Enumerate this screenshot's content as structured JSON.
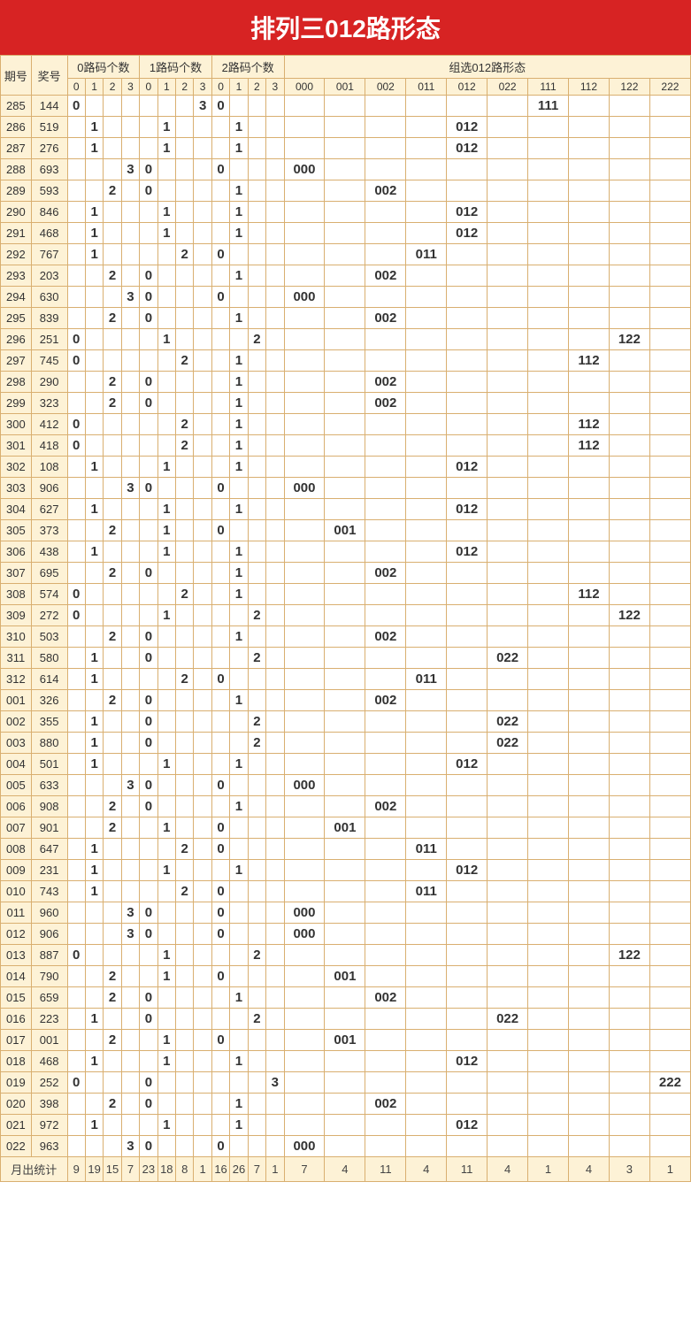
{
  "title": "排列三012路形态",
  "header": {
    "period": "期号",
    "prize": "奖号",
    "group0": "0路码个数",
    "group1": "1路码个数",
    "group2": "2路码个数",
    "pattern": "组选012路形态",
    "counts": [
      "0",
      "1",
      "2",
      "3"
    ],
    "patterns": [
      "000",
      "001",
      "002",
      "011",
      "012",
      "022",
      "111",
      "112",
      "122",
      "222"
    ],
    "footer": "月出统计"
  },
  "rows": [
    {
      "q": "285",
      "p": "144",
      "c0": [
        0,
        null,
        null,
        null
      ],
      "c1": [
        null,
        null,
        null,
        3
      ],
      "c2": [
        0,
        null,
        null,
        null
      ],
      "pat": "111"
    },
    {
      "q": "286",
      "p": "519",
      "c0": [
        null,
        1,
        null,
        null
      ],
      "c1": [
        null,
        1,
        null,
        null
      ],
      "c2": [
        null,
        1,
        null,
        null
      ],
      "pat": "012"
    },
    {
      "q": "287",
      "p": "276",
      "c0": [
        null,
        1,
        null,
        null
      ],
      "c1": [
        null,
        1,
        null,
        null
      ],
      "c2": [
        null,
        1,
        null,
        null
      ],
      "pat": "012"
    },
    {
      "q": "288",
      "p": "693",
      "c0": [
        null,
        null,
        null,
        3
      ],
      "c1": [
        0,
        null,
        null,
        null
      ],
      "c2": [
        0,
        null,
        null,
        null
      ],
      "pat": "000"
    },
    {
      "q": "289",
      "p": "593",
      "c0": [
        null,
        null,
        2,
        null
      ],
      "c1": [
        0,
        null,
        null,
        null
      ],
      "c2": [
        null,
        1,
        null,
        null
      ],
      "pat": "002"
    },
    {
      "q": "290",
      "p": "846",
      "c0": [
        null,
        1,
        null,
        null
      ],
      "c1": [
        null,
        1,
        null,
        null
      ],
      "c2": [
        null,
        1,
        null,
        null
      ],
      "pat": "012"
    },
    {
      "q": "291",
      "p": "468",
      "c0": [
        null,
        1,
        null,
        null
      ],
      "c1": [
        null,
        1,
        null,
        null
      ],
      "c2": [
        null,
        1,
        null,
        null
      ],
      "pat": "012"
    },
    {
      "q": "292",
      "p": "767",
      "c0": [
        null,
        1,
        null,
        null
      ],
      "c1": [
        null,
        null,
        2,
        null
      ],
      "c2": [
        0,
        null,
        null,
        null
      ],
      "pat": "011"
    },
    {
      "q": "293",
      "p": "203",
      "c0": [
        null,
        null,
        2,
        null
      ],
      "c1": [
        0,
        null,
        null,
        null
      ],
      "c2": [
        null,
        1,
        null,
        null
      ],
      "pat": "002"
    },
    {
      "q": "294",
      "p": "630",
      "c0": [
        null,
        null,
        null,
        3
      ],
      "c1": [
        0,
        null,
        null,
        null
      ],
      "c2": [
        0,
        null,
        null,
        null
      ],
      "pat": "000"
    },
    {
      "q": "295",
      "p": "839",
      "c0": [
        null,
        null,
        2,
        null
      ],
      "c1": [
        0,
        null,
        null,
        null
      ],
      "c2": [
        null,
        1,
        null,
        null
      ],
      "pat": "002"
    },
    {
      "q": "296",
      "p": "251",
      "c0": [
        0,
        null,
        null,
        null
      ],
      "c1": [
        null,
        1,
        null,
        null
      ],
      "c2": [
        null,
        null,
        2,
        null
      ],
      "pat": "122"
    },
    {
      "q": "297",
      "p": "745",
      "c0": [
        0,
        null,
        null,
        null
      ],
      "c1": [
        null,
        null,
        2,
        null
      ],
      "c2": [
        null,
        1,
        null,
        null
      ],
      "pat": "112"
    },
    {
      "q": "298",
      "p": "290",
      "c0": [
        null,
        null,
        2,
        null
      ],
      "c1": [
        0,
        null,
        null,
        null
      ],
      "c2": [
        null,
        1,
        null,
        null
      ],
      "pat": "002"
    },
    {
      "q": "299",
      "p": "323",
      "c0": [
        null,
        null,
        2,
        null
      ],
      "c1": [
        0,
        null,
        null,
        null
      ],
      "c2": [
        null,
        1,
        null,
        null
      ],
      "pat": "002"
    },
    {
      "q": "300",
      "p": "412",
      "c0": [
        0,
        null,
        null,
        null
      ],
      "c1": [
        null,
        null,
        2,
        null
      ],
      "c2": [
        null,
        1,
        null,
        null
      ],
      "pat": "112"
    },
    {
      "q": "301",
      "p": "418",
      "c0": [
        0,
        null,
        null,
        null
      ],
      "c1": [
        null,
        null,
        2,
        null
      ],
      "c2": [
        null,
        1,
        null,
        null
      ],
      "pat": "112"
    },
    {
      "q": "302",
      "p": "108",
      "c0": [
        null,
        1,
        null,
        null
      ],
      "c1": [
        null,
        1,
        null,
        null
      ],
      "c2": [
        null,
        1,
        null,
        null
      ],
      "pat": "012"
    },
    {
      "q": "303",
      "p": "906",
      "c0": [
        null,
        null,
        null,
        3
      ],
      "c1": [
        0,
        null,
        null,
        null
      ],
      "c2": [
        0,
        null,
        null,
        null
      ],
      "pat": "000"
    },
    {
      "q": "304",
      "p": "627",
      "c0": [
        null,
        1,
        null,
        null
      ],
      "c1": [
        null,
        1,
        null,
        null
      ],
      "c2": [
        null,
        1,
        null,
        null
      ],
      "pat": "012"
    },
    {
      "q": "305",
      "p": "373",
      "c0": [
        null,
        null,
        2,
        null
      ],
      "c1": [
        null,
        1,
        null,
        null
      ],
      "c2": [
        0,
        null,
        null,
        null
      ],
      "pat": "001"
    },
    {
      "q": "306",
      "p": "438",
      "c0": [
        null,
        1,
        null,
        null
      ],
      "c1": [
        null,
        1,
        null,
        null
      ],
      "c2": [
        null,
        1,
        null,
        null
      ],
      "pat": "012"
    },
    {
      "q": "307",
      "p": "695",
      "c0": [
        null,
        null,
        2,
        null
      ],
      "c1": [
        0,
        null,
        null,
        null
      ],
      "c2": [
        null,
        1,
        null,
        null
      ],
      "pat": "002"
    },
    {
      "q": "308",
      "p": "574",
      "c0": [
        0,
        null,
        null,
        null
      ],
      "c1": [
        null,
        null,
        2,
        null
      ],
      "c2": [
        null,
        1,
        null,
        null
      ],
      "pat": "112"
    },
    {
      "q": "309",
      "p": "272",
      "c0": [
        0,
        null,
        null,
        null
      ],
      "c1": [
        null,
        1,
        null,
        null
      ],
      "c2": [
        null,
        null,
        2,
        null
      ],
      "pat": "122"
    },
    {
      "q": "310",
      "p": "503",
      "c0": [
        null,
        null,
        2,
        null
      ],
      "c1": [
        0,
        null,
        null,
        null
      ],
      "c2": [
        null,
        1,
        null,
        null
      ],
      "pat": "002"
    },
    {
      "q": "311",
      "p": "580",
      "c0": [
        null,
        1,
        null,
        null
      ],
      "c1": [
        0,
        null,
        null,
        null
      ],
      "c2": [
        null,
        null,
        2,
        null
      ],
      "pat": "022"
    },
    {
      "q": "312",
      "p": "614",
      "c0": [
        null,
        1,
        null,
        null
      ],
      "c1": [
        null,
        null,
        2,
        null
      ],
      "c2": [
        0,
        null,
        null,
        null
      ],
      "pat": "011"
    },
    {
      "q": "001",
      "p": "326",
      "c0": [
        null,
        null,
        2,
        null
      ],
      "c1": [
        0,
        null,
        null,
        null
      ],
      "c2": [
        null,
        1,
        null,
        null
      ],
      "pat": "002"
    },
    {
      "q": "002",
      "p": "355",
      "c0": [
        null,
        1,
        null,
        null
      ],
      "c1": [
        0,
        null,
        null,
        null
      ],
      "c2": [
        null,
        null,
        2,
        null
      ],
      "pat": "022"
    },
    {
      "q": "003",
      "p": "880",
      "c0": [
        null,
        1,
        null,
        null
      ],
      "c1": [
        0,
        null,
        null,
        null
      ],
      "c2": [
        null,
        null,
        2,
        null
      ],
      "pat": "022"
    },
    {
      "q": "004",
      "p": "501",
      "c0": [
        null,
        1,
        null,
        null
      ],
      "c1": [
        null,
        1,
        null,
        null
      ],
      "c2": [
        null,
        1,
        null,
        null
      ],
      "pat": "012"
    },
    {
      "q": "005",
      "p": "633",
      "c0": [
        null,
        null,
        null,
        3
      ],
      "c1": [
        0,
        null,
        null,
        null
      ],
      "c2": [
        0,
        null,
        null,
        null
      ],
      "pat": "000"
    },
    {
      "q": "006",
      "p": "908",
      "c0": [
        null,
        null,
        2,
        null
      ],
      "c1": [
        0,
        null,
        null,
        null
      ],
      "c2": [
        null,
        1,
        null,
        null
      ],
      "pat": "002"
    },
    {
      "q": "007",
      "p": "901",
      "c0": [
        null,
        null,
        2,
        null
      ],
      "c1": [
        null,
        1,
        null,
        null
      ],
      "c2": [
        0,
        null,
        null,
        null
      ],
      "pat": "001"
    },
    {
      "q": "008",
      "p": "647",
      "c0": [
        null,
        1,
        null,
        null
      ],
      "c1": [
        null,
        null,
        2,
        null
      ],
      "c2": [
        0,
        null,
        null,
        null
      ],
      "pat": "011"
    },
    {
      "q": "009",
      "p": "231",
      "c0": [
        null,
        1,
        null,
        null
      ],
      "c1": [
        null,
        1,
        null,
        null
      ],
      "c2": [
        null,
        1,
        null,
        null
      ],
      "pat": "012"
    },
    {
      "q": "010",
      "p": "743",
      "c0": [
        null,
        1,
        null,
        null
      ],
      "c1": [
        null,
        null,
        2,
        null
      ],
      "c2": [
        0,
        null,
        null,
        null
      ],
      "pat": "011"
    },
    {
      "q": "011",
      "p": "960",
      "c0": [
        null,
        null,
        null,
        3
      ],
      "c1": [
        0,
        null,
        null,
        null
      ],
      "c2": [
        0,
        null,
        null,
        null
      ],
      "pat": "000"
    },
    {
      "q": "012",
      "p": "906",
      "c0": [
        null,
        null,
        null,
        3
      ],
      "c1": [
        0,
        null,
        null,
        null
      ],
      "c2": [
        0,
        null,
        null,
        null
      ],
      "pat": "000"
    },
    {
      "q": "013",
      "p": "887",
      "c0": [
        0,
        null,
        null,
        null
      ],
      "c1": [
        null,
        1,
        null,
        null
      ],
      "c2": [
        null,
        null,
        2,
        null
      ],
      "pat": "122"
    },
    {
      "q": "014",
      "p": "790",
      "c0": [
        null,
        null,
        2,
        null
      ],
      "c1": [
        null,
        1,
        null,
        null
      ],
      "c2": [
        0,
        null,
        null,
        null
      ],
      "pat": "001"
    },
    {
      "q": "015",
      "p": "659",
      "c0": [
        null,
        null,
        2,
        null
      ],
      "c1": [
        0,
        null,
        null,
        null
      ],
      "c2": [
        null,
        1,
        null,
        null
      ],
      "pat": "002"
    },
    {
      "q": "016",
      "p": "223",
      "c0": [
        null,
        1,
        null,
        null
      ],
      "c1": [
        0,
        null,
        null,
        null
      ],
      "c2": [
        null,
        null,
        2,
        null
      ],
      "pat": "022"
    },
    {
      "q": "017",
      "p": "001",
      "c0": [
        null,
        null,
        2,
        null
      ],
      "c1": [
        null,
        1,
        null,
        null
      ],
      "c2": [
        0,
        null,
        null,
        null
      ],
      "pat": "001"
    },
    {
      "q": "018",
      "p": "468",
      "c0": [
        null,
        1,
        null,
        null
      ],
      "c1": [
        null,
        1,
        null,
        null
      ],
      "c2": [
        null,
        1,
        null,
        null
      ],
      "pat": "012"
    },
    {
      "q": "019",
      "p": "252",
      "c0": [
        0,
        null,
        null,
        null
      ],
      "c1": [
        0,
        null,
        null,
        null
      ],
      "c2": [
        null,
        null,
        null,
        3
      ],
      "pat": "222"
    },
    {
      "q": "020",
      "p": "398",
      "c0": [
        null,
        null,
        2,
        null
      ],
      "c1": [
        0,
        null,
        null,
        null
      ],
      "c2": [
        null,
        1,
        null,
        null
      ],
      "pat": "002"
    },
    {
      "q": "021",
      "p": "972",
      "c0": [
        null,
        1,
        null,
        null
      ],
      "c1": [
        null,
        1,
        null,
        null
      ],
      "c2": [
        null,
        1,
        null,
        null
      ],
      "pat": "012"
    },
    {
      "q": "022",
      "p": "963",
      "c0": [
        null,
        null,
        null,
        3
      ],
      "c1": [
        0,
        null,
        null,
        null
      ],
      "c2": [
        0,
        null,
        null,
        null
      ],
      "pat": "000"
    }
  ],
  "footer": {
    "c0": [
      9,
      19,
      15,
      7
    ],
    "c1": [
      23,
      18,
      8,
      1
    ],
    "c2": [
      16,
      26,
      7,
      1
    ],
    "pat": [
      7,
      4,
      11,
      4,
      11,
      4,
      1,
      4,
      3,
      1
    ]
  }
}
